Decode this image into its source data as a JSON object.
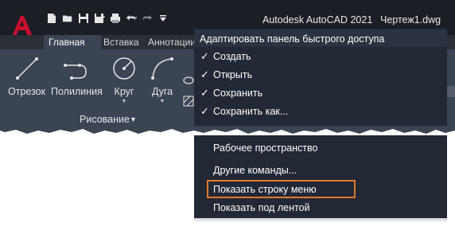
{
  "app": {
    "title": "Autodesk AutoCAD 2021",
    "document": "Чертеж1.dwg",
    "logo_letter": "A",
    "brand_color": "#c8102e"
  },
  "quick_access": {
    "icons": [
      "new-icon",
      "open-icon",
      "save-icon",
      "save-as-icon",
      "print-icon",
      "undo-icon",
      "redo-icon",
      "customize-dropdown-icon"
    ]
  },
  "tabs": [
    {
      "label": "Главная",
      "active": true
    },
    {
      "label": "Вставка",
      "active": false
    },
    {
      "label": "Аннотации",
      "active": false
    }
  ],
  "ribbon": {
    "tools": [
      {
        "label": "Отрезок",
        "has_arrow": false
      },
      {
        "label": "Полилиния",
        "has_arrow": false
      },
      {
        "label": "Круг",
        "has_arrow": true
      },
      {
        "label": "Дуга",
        "has_arrow": true
      }
    ],
    "panel_label": "Рисование",
    "panel_arrow": "▼"
  },
  "menu": {
    "header": "Адаптировать панель быстрого доступа",
    "items_top": [
      {
        "label": "Создать",
        "checked": true
      },
      {
        "label": "Открыть",
        "checked": true
      },
      {
        "label": "Сохранить",
        "checked": true
      },
      {
        "label": "Сохранить как...",
        "checked": true
      }
    ],
    "items_bottom": [
      {
        "label": "Рабочее пространство",
        "checked": false
      },
      {
        "label": "Другие команды...",
        "checked": false
      },
      {
        "label": "Показать строку меню",
        "checked": false,
        "highlighted": true
      },
      {
        "label": "Показать под лентой",
        "checked": false
      }
    ],
    "check_glyph": "✓",
    "highlight_color": "#e07a2a"
  }
}
